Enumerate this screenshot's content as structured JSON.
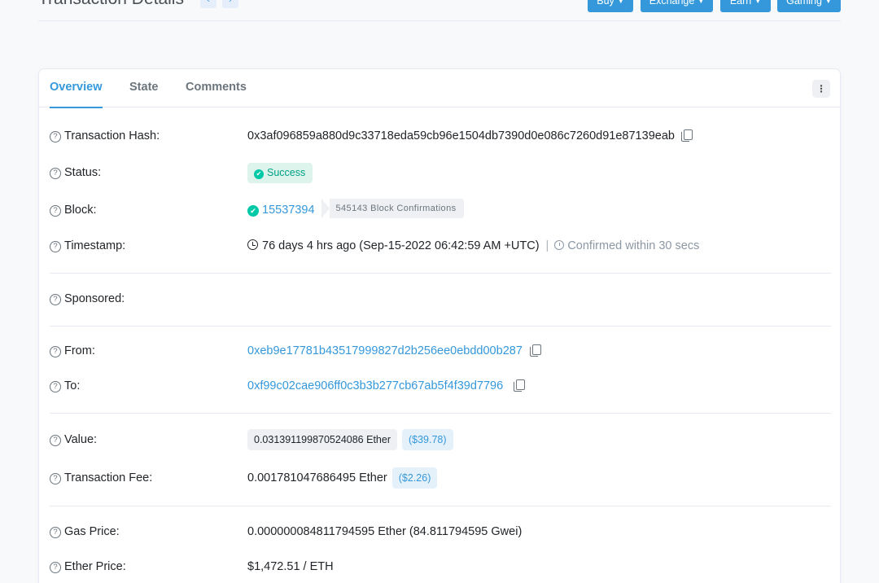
{
  "header": {
    "title": "Transaction Details",
    "prev_arrow": "‹",
    "next_arrow": "›",
    "buttons": [
      "Buy",
      "Exchange",
      "Earn",
      "Gaming"
    ]
  },
  "tabs": [
    "Overview",
    "State",
    "Comments"
  ],
  "more_icon": "⋮",
  "rows": {
    "tx_hash": {
      "label": "Transaction Hash:",
      "value": "0x3af096859a880d9c33718eda59cb96e1504db7390d0e086c7260d91e87139eab"
    },
    "status": {
      "label": "Status:",
      "value": "Success"
    },
    "block": {
      "label": "Block:",
      "value": "15537394",
      "confirmations": "545143 Block Confirmations"
    },
    "timestamp": {
      "label": "Timestamp:",
      "value": "76 days 4 hrs ago (Sep-15-2022 06:42:59 AM +UTC)",
      "separator": "|",
      "confirmed": "Confirmed within 30 secs"
    },
    "sponsored": {
      "label": "Sponsored:"
    },
    "from": {
      "label": "From:",
      "value": "0xeb9e17781b43517999827d2b256ee0ebdd00b287"
    },
    "to": {
      "label": "To:",
      "value": "0xf99c02cae906ff0c3b3b277cb67ab5f4f39d7796"
    },
    "value": {
      "label": "Value:",
      "value": "0.031391199870524086 Ether",
      "usd": "($39.78)"
    },
    "fee": {
      "label": "Transaction Fee:",
      "value": "0.001781047686495 Ether",
      "usd": "($2.26)"
    },
    "gas_price": {
      "label": "Gas Price:",
      "value": "0.000000084811794595 Ether (84.811794595 Gwei)"
    },
    "ether_price": {
      "label": "Ether Price:",
      "value": "$1,472.51 / ETH"
    }
  },
  "colors": {
    "accent": "#3498db",
    "success": "#00c9a7",
    "muted": "#8c98a4"
  }
}
